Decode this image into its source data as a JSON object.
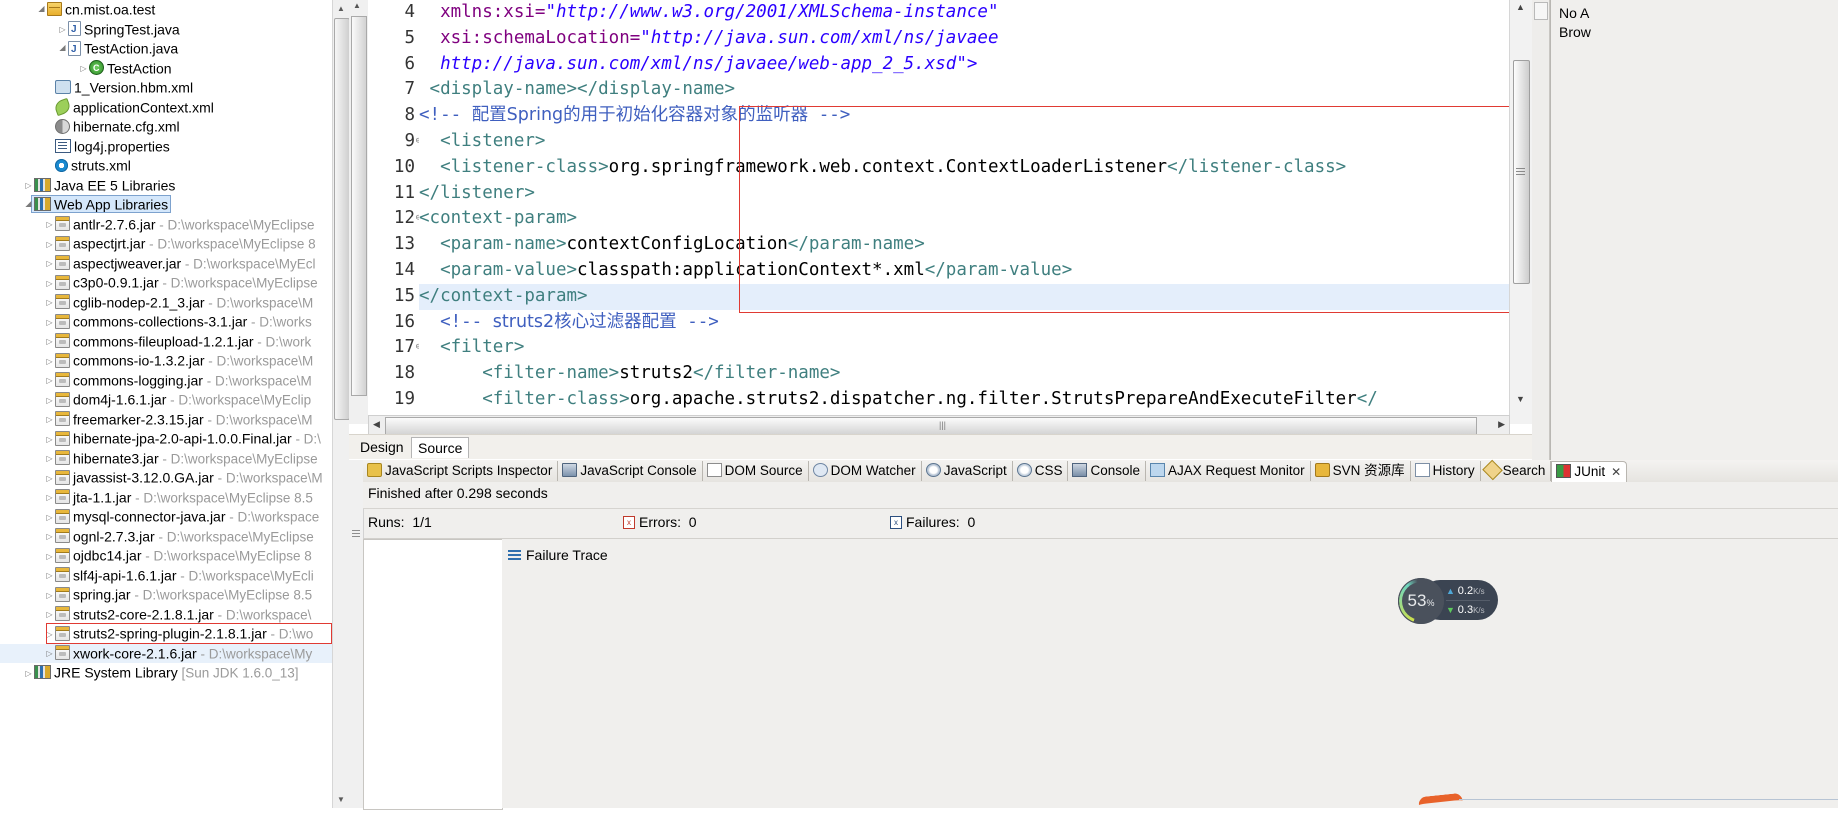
{
  "explorer": {
    "name": "package-explorer",
    "rows": [
      {
        "indent": 47,
        "arrow": "open",
        "icon": "package-icon",
        "label": "cn.mist.oa.test",
        "path": "",
        "state": "normal"
      },
      {
        "indent": 68,
        "arrow": "closed",
        "icon": "java-file-icon",
        "label": "SpringTest.java",
        "path": "",
        "state": "normal"
      },
      {
        "indent": 68,
        "arrow": "open",
        "icon": "java-file-icon",
        "label": "TestAction.java",
        "path": "",
        "state": "normal"
      },
      {
        "indent": 89,
        "arrow": "closed",
        "icon": "java-class-icon",
        "label": "TestAction",
        "path": "",
        "state": "normal"
      },
      {
        "indent": 55,
        "arrow": "none",
        "icon": "hbm-xml-icon",
        "label": "1_Version.hbm.xml",
        "path": "",
        "state": "normal"
      },
      {
        "indent": 55,
        "arrow": "none",
        "icon": "spring-leaf-icon",
        "label": "applicationContext.xml",
        "path": "",
        "state": "normal"
      },
      {
        "indent": 55,
        "arrow": "none",
        "icon": "hibernate-cfg-icon",
        "label": "hibernate.cfg.xml",
        "path": "",
        "state": "normal"
      },
      {
        "indent": 55,
        "arrow": "none",
        "icon": "properties-icon",
        "label": "log4j.properties",
        "path": "",
        "state": "normal"
      },
      {
        "indent": 55,
        "arrow": "none",
        "icon": "struts-gear-icon",
        "label": "struts.xml",
        "path": "",
        "state": "normal"
      },
      {
        "indent": 34,
        "arrow": "closed",
        "icon": "library-books-icon",
        "label": "Java EE 5 Libraries",
        "path": "",
        "state": "normal"
      },
      {
        "indent": 34,
        "arrow": "open",
        "icon": "library-books-icon",
        "label": "Web App Libraries",
        "path": "",
        "state": "selected"
      },
      {
        "indent": 55,
        "arrow": "closed",
        "icon": "jar-icon",
        "label": "antlr-2.7.6.jar",
        "path": " - D:\\workspace\\MyEclipse",
        "state": "normal"
      },
      {
        "indent": 55,
        "arrow": "closed",
        "icon": "jar-icon",
        "label": "aspectjrt.jar",
        "path": " - D:\\workspace\\MyEclipse 8",
        "state": "normal"
      },
      {
        "indent": 55,
        "arrow": "closed",
        "icon": "jar-icon",
        "label": "aspectjweaver.jar",
        "path": " - D:\\workspace\\MyEcl",
        "state": "normal"
      },
      {
        "indent": 55,
        "arrow": "closed",
        "icon": "jar-icon",
        "label": "c3p0-0.9.1.jar",
        "path": " - D:\\workspace\\MyEclipse",
        "state": "normal"
      },
      {
        "indent": 55,
        "arrow": "closed",
        "icon": "jar-icon",
        "label": "cglib-nodep-2.1_3.jar",
        "path": " - D:\\workspace\\M",
        "state": "normal"
      },
      {
        "indent": 55,
        "arrow": "closed",
        "icon": "jar-icon",
        "label": "commons-collections-3.1.jar",
        "path": " - D:\\works",
        "state": "normal"
      },
      {
        "indent": 55,
        "arrow": "closed",
        "icon": "jar-icon",
        "label": "commons-fileupload-1.2.1.jar",
        "path": " - D:\\work",
        "state": "normal"
      },
      {
        "indent": 55,
        "arrow": "closed",
        "icon": "jar-icon",
        "label": "commons-io-1.3.2.jar",
        "path": " - D:\\workspace\\M",
        "state": "normal"
      },
      {
        "indent": 55,
        "arrow": "closed",
        "icon": "jar-icon",
        "label": "commons-logging.jar",
        "path": " - D:\\workspace\\M",
        "state": "normal"
      },
      {
        "indent": 55,
        "arrow": "closed",
        "icon": "jar-icon",
        "label": "dom4j-1.6.1.jar",
        "path": " - D:\\workspace\\MyEclip",
        "state": "normal"
      },
      {
        "indent": 55,
        "arrow": "closed",
        "icon": "jar-icon",
        "label": "freemarker-2.3.15.jar",
        "path": " - D:\\workspace\\M",
        "state": "normal"
      },
      {
        "indent": 55,
        "arrow": "closed",
        "icon": "jar-icon",
        "label": "hibernate-jpa-2.0-api-1.0.0.Final.jar",
        "path": " - D:\\",
        "state": "normal"
      },
      {
        "indent": 55,
        "arrow": "closed",
        "icon": "jar-icon",
        "label": "hibernate3.jar",
        "path": " - D:\\workspace\\MyEclipse",
        "state": "normal"
      },
      {
        "indent": 55,
        "arrow": "closed",
        "icon": "jar-icon",
        "label": "javassist-3.12.0.GA.jar",
        "path": " - D:\\workspace\\M",
        "state": "normal"
      },
      {
        "indent": 55,
        "arrow": "closed",
        "icon": "jar-icon",
        "label": "jta-1.1.jar",
        "path": " - D:\\workspace\\MyEclipse 8.5",
        "state": "normal"
      },
      {
        "indent": 55,
        "arrow": "closed",
        "icon": "jar-icon",
        "label": "mysql-connector-java.jar",
        "path": " - D:\\workspace",
        "state": "normal"
      },
      {
        "indent": 55,
        "arrow": "closed",
        "icon": "jar-icon",
        "label": "ognl-2.7.3.jar",
        "path": " - D:\\workspace\\MyEclipse",
        "state": "normal"
      },
      {
        "indent": 55,
        "arrow": "closed",
        "icon": "jar-icon",
        "label": "ojdbc14.jar",
        "path": " - D:\\workspace\\MyEclipse 8",
        "state": "normal"
      },
      {
        "indent": 55,
        "arrow": "closed",
        "icon": "jar-icon",
        "label": "slf4j-api-1.6.1.jar",
        "path": " - D:\\workspace\\MyEcli",
        "state": "normal"
      },
      {
        "indent": 55,
        "arrow": "closed",
        "icon": "jar-icon",
        "label": "spring.jar",
        "path": " - D:\\workspace\\MyEclipse 8.5",
        "state": "normal"
      },
      {
        "indent": 55,
        "arrow": "closed",
        "icon": "jar-icon",
        "label": "struts2-core-2.1.8.1.jar",
        "path": " - D:\\workspace\\",
        "state": "normal"
      },
      {
        "indent": 55,
        "arrow": "closed",
        "icon": "jar-icon",
        "label": "struts2-spring-plugin-2.1.8.1.jar",
        "path": " - D:\\wo",
        "state": "highlighted"
      },
      {
        "indent": 55,
        "arrow": "closed",
        "icon": "jar-icon",
        "label": "xwork-core-2.1.6.jar",
        "path": " - D:\\workspace\\My",
        "state": "light"
      },
      {
        "indent": 34,
        "arrow": "closed",
        "icon": "library-books-icon",
        "label": "JRE System Library",
        "path": " [Sun JDK 1.6.0_13]",
        "state": "normal"
      }
    ]
  },
  "editor": {
    "name": "web-xml-source-editor",
    "lines": [
      {
        "num": "4",
        "fold": "",
        "highlight": false,
        "segments": [
          {
            "t": "  ",
            "c": "txt"
          },
          {
            "t": "xmlns:xsi=",
            "c": "attr"
          },
          {
            "t": "\"http://www.w3.org/2001/XMLSchema-instance\"",
            "c": "str"
          }
        ]
      },
      {
        "num": "5",
        "fold": "",
        "highlight": false,
        "segments": [
          {
            "t": "  ",
            "c": "txt"
          },
          {
            "t": "xsi:schemaLocation=",
            "c": "attr"
          },
          {
            "t": "\"http://java.sun.com/xml/ns/javaee",
            "c": "str"
          }
        ]
      },
      {
        "num": "6",
        "fold": "",
        "highlight": false,
        "segments": [
          {
            "t": "  ",
            "c": "txt"
          },
          {
            "t": "http://java.sun.com/xml/ns/javaee/web-app_2_5.xsd\">",
            "c": "str"
          }
        ]
      },
      {
        "num": "7",
        "fold": "",
        "highlight": false,
        "segments": [
          {
            "t": " <display-name></display-name>",
            "c": "tag"
          }
        ]
      },
      {
        "num": "8",
        "fold": "",
        "highlight": false,
        "segments": [
          {
            "t": "<!-- ",
            "c": "cmt"
          },
          {
            "t": "配置Spring的用于初始化容器对象的监听器",
            "c": "cmt-cn"
          },
          {
            "t": " -->",
            "c": "cmt"
          }
        ]
      },
      {
        "num": "9",
        "fold": "-",
        "highlight": false,
        "segments": [
          {
            "t": "  <listener>",
            "c": "tag"
          }
        ]
      },
      {
        "num": "10",
        "fold": "",
        "highlight": false,
        "segments": [
          {
            "t": "  <listener-class>",
            "c": "tag"
          },
          {
            "t": "org.springframework.web.context.ContextLoaderListener",
            "c": "txt"
          },
          {
            "t": "</listener-class>",
            "c": "tag"
          }
        ]
      },
      {
        "num": "11",
        "fold": "",
        "highlight": false,
        "segments": [
          {
            "t": "</listener>",
            "c": "tag"
          }
        ]
      },
      {
        "num": "12",
        "fold": "-",
        "highlight": false,
        "segments": [
          {
            "t": "<context-param>",
            "c": "tag"
          }
        ]
      },
      {
        "num": "13",
        "fold": "",
        "highlight": false,
        "segments": [
          {
            "t": "  <param-name>",
            "c": "tag"
          },
          {
            "t": "contextConfigLocation",
            "c": "txt"
          },
          {
            "t": "</param-name>",
            "c": "tag"
          }
        ]
      },
      {
        "num": "14",
        "fold": "",
        "highlight": false,
        "segments": [
          {
            "t": "  <param-value>",
            "c": "tag"
          },
          {
            "t": "classpath:applicationContext*.xml",
            "c": "txt"
          },
          {
            "t": "</param-value>",
            "c": "tag"
          }
        ]
      },
      {
        "num": "15",
        "fold": "",
        "highlight": true,
        "segments": [
          {
            "t": "</context-param>",
            "c": "tag"
          }
        ]
      },
      {
        "num": "16",
        "fold": "",
        "highlight": false,
        "segments": [
          {
            "t": "  <!-- ",
            "c": "cmt"
          },
          {
            "t": "struts2核心过滤器配置",
            "c": "cmt-cn"
          },
          {
            "t": " -->",
            "c": "cmt"
          }
        ]
      },
      {
        "num": "17",
        "fold": "-",
        "highlight": false,
        "segments": [
          {
            "t": "  <filter>",
            "c": "tag"
          }
        ]
      },
      {
        "num": "18",
        "fold": "",
        "highlight": false,
        "segments": [
          {
            "t": "      <filter-name>",
            "c": "tag"
          },
          {
            "t": "struts2",
            "c": "txt"
          },
          {
            "t": "</filter-name>",
            "c": "tag"
          }
        ]
      },
      {
        "num": "19",
        "fold": "",
        "highlight": false,
        "segments": [
          {
            "t": "      <filter-class>",
            "c": "tag"
          },
          {
            "t": "org.apache.struts2.dispatcher.ng.filter.StrutsPrepareAndExecuteFilter",
            "c": "txt"
          },
          {
            "t": "</",
            "c": "tag"
          }
        ]
      }
    ],
    "design_tab": "Design",
    "source_tab": "Source"
  },
  "right_panel": {
    "name": "outline-panel",
    "message": "No A\nBrow"
  },
  "bottom_panel": {
    "tabs": [
      {
        "label": "JavaScript Scripts Inspector",
        "icon": "javascript-inspector-icon",
        "active": false
      },
      {
        "label": "JavaScript Console",
        "icon": "javascript-console-icon",
        "active": false
      },
      {
        "label": "DOM Source",
        "icon": "dom-source-icon",
        "active": false
      },
      {
        "label": "DOM Watcher",
        "icon": "dom-watcher-icon",
        "active": false
      },
      {
        "label": "JavaScript",
        "icon": "javascript-icon",
        "active": false
      },
      {
        "label": "CSS",
        "icon": "css-icon",
        "active": false
      },
      {
        "label": "Console",
        "icon": "console-icon",
        "active": false
      },
      {
        "label": "AJAX Request Monitor",
        "icon": "ajax-monitor-icon",
        "active": false
      },
      {
        "label": "SVN 资源库",
        "icon": "svn-repository-icon",
        "active": false
      },
      {
        "label": "History",
        "icon": "history-icon",
        "active": false
      },
      {
        "label": "Search",
        "icon": "search-icon",
        "active": false
      },
      {
        "label": "JUnit",
        "icon": "junit-icon",
        "active": true
      }
    ],
    "close_glyph": "✕",
    "status": "Finished after 0.298 seconds",
    "runs_label": "Runs:",
    "runs_value": "1/1",
    "errors_label": "Errors:",
    "errors_value": "0",
    "failures_label": "Failures:",
    "failures_value": "0",
    "failure_trace_label": "Failure Trace",
    "progress_color": "#5cb85c",
    "toolbar_icons": [
      "next-failure-icon",
      "previous-failure-icon",
      "show-failures-only-icon",
      "scroll-lock-icon",
      "rerun-test-icon",
      "rerun-failed-icon",
      "stop-icon"
    ]
  },
  "net_widget": {
    "name": "network-speed-widget",
    "percent": "53",
    "percent_unit": "%",
    "upload_value": "0.2",
    "upload_unit": "K/s",
    "download_value": "0.3",
    "download_unit": "K/s"
  }
}
